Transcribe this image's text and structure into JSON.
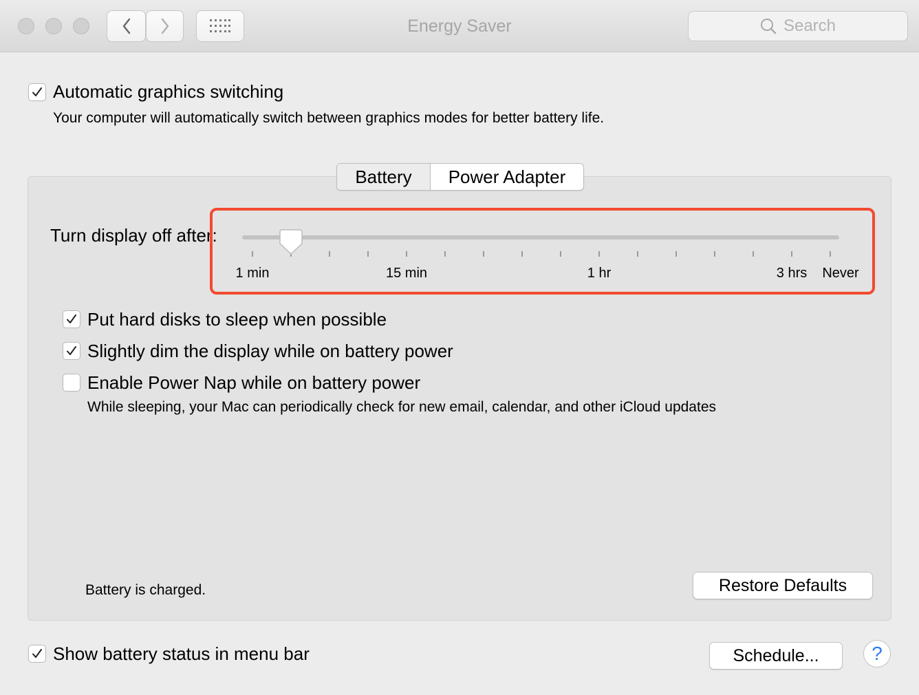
{
  "window": {
    "title": "Energy Saver"
  },
  "toolbar": {
    "search_placeholder": "Search"
  },
  "graphics": {
    "checked": true,
    "label": "Automatic graphics switching",
    "description": "Your computer will automatically switch between graphics modes for better battery life."
  },
  "tabs": [
    {
      "label": "Battery",
      "selected": false
    },
    {
      "label": "Power Adapter",
      "selected": true
    }
  ],
  "display_sleep": {
    "label": "Turn display off after:",
    "value": "5 min",
    "tick_labels": [
      "1 min",
      "15 min",
      "1 hr",
      "3 hrs",
      "Never"
    ]
  },
  "options": [
    {
      "label": "Put hard disks to sleep when possible",
      "checked": true
    },
    {
      "label": "Slightly dim the display while on battery power",
      "checked": true
    },
    {
      "label": "Enable Power Nap while on battery power",
      "checked": false,
      "description": "While sleeping, your Mac can periodically check for new email, calendar, and other iCloud updates"
    }
  ],
  "status_text": "Battery is charged.",
  "buttons": {
    "restore_defaults": "Restore Defaults",
    "schedule": "Schedule...",
    "help": "?"
  },
  "menu_bar_status": {
    "label": "Show battery status in menu bar",
    "checked": true
  },
  "colors": {
    "highlight": "#f24a2f",
    "help_icon": "#2e7cf6"
  }
}
